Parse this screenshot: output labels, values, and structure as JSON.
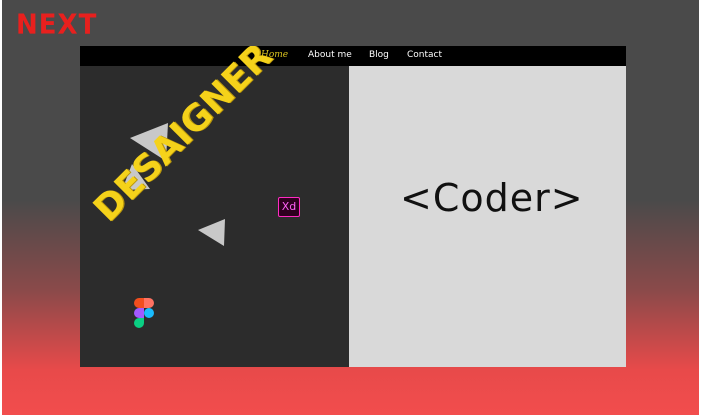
{
  "brand": {
    "logo_text": "NEXT"
  },
  "nav": {
    "items": [
      {
        "label": "Home",
        "active": true
      },
      {
        "label": "About me",
        "active": false
      },
      {
        "label": "Blog",
        "active": false
      },
      {
        "label": "Contact",
        "active": false
      }
    ]
  },
  "hero": {
    "left_title": "DESAIGNER",
    "right_title": "<Coder>",
    "xd_icon_label": "Xd"
  },
  "colors": {
    "accent_yellow": "#f5d21a",
    "brand_red": "#e8201e",
    "dark_panel": "#2c2c2c",
    "light_panel": "#d9d9d9"
  },
  "icons": {
    "xd": "adobe-xd-icon",
    "figma": "figma-icon"
  }
}
